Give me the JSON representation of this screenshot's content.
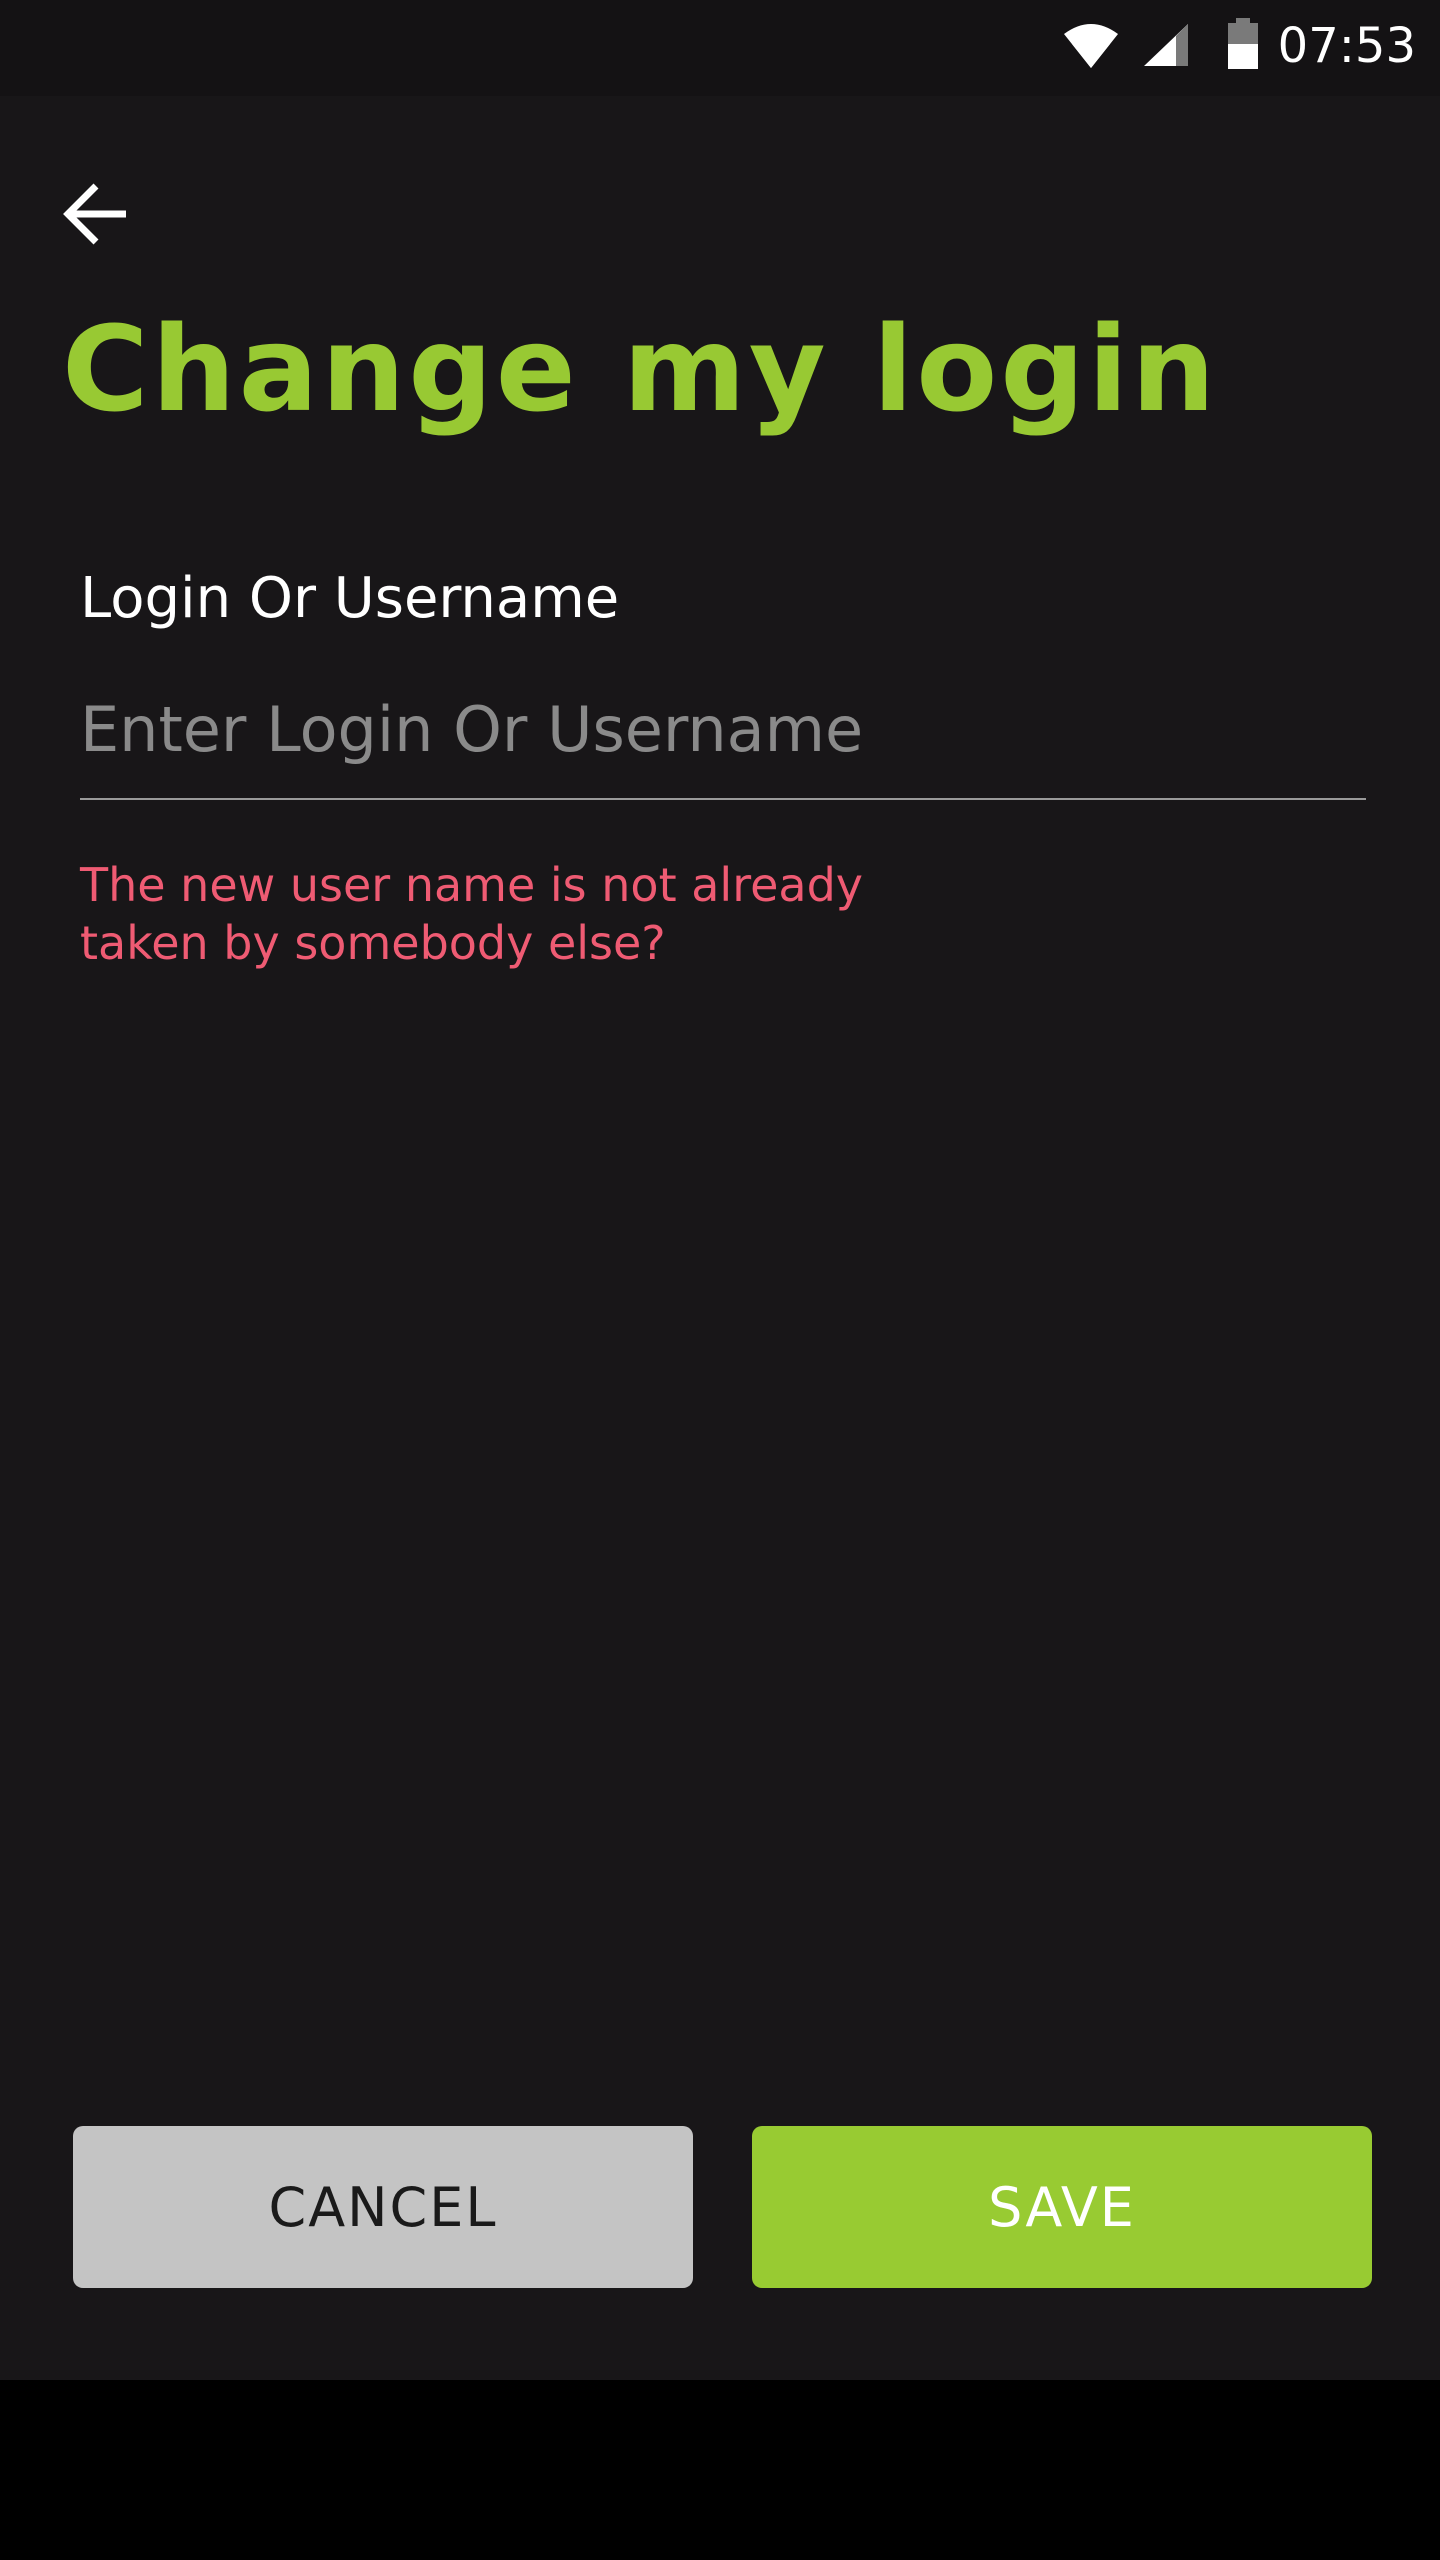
{
  "status_bar": {
    "time": "07:53",
    "icons": [
      "wifi-icon",
      "cell-signal-icon",
      "battery-icon"
    ]
  },
  "header": {
    "back_icon": "arrow-left-icon",
    "title": "Change my login"
  },
  "form": {
    "label": "Login Or Username",
    "input_value": "",
    "input_placeholder": "Enter Login Or Username",
    "error_message": "The new user name is not already taken by somebody else?"
  },
  "actions": {
    "cancel_label": "CANCEL",
    "save_label": "SAVE"
  },
  "colors": {
    "background": "#181618",
    "accent": "#98c933",
    "error": "#ef5b73",
    "cancel_button": "#c4c4c4"
  }
}
